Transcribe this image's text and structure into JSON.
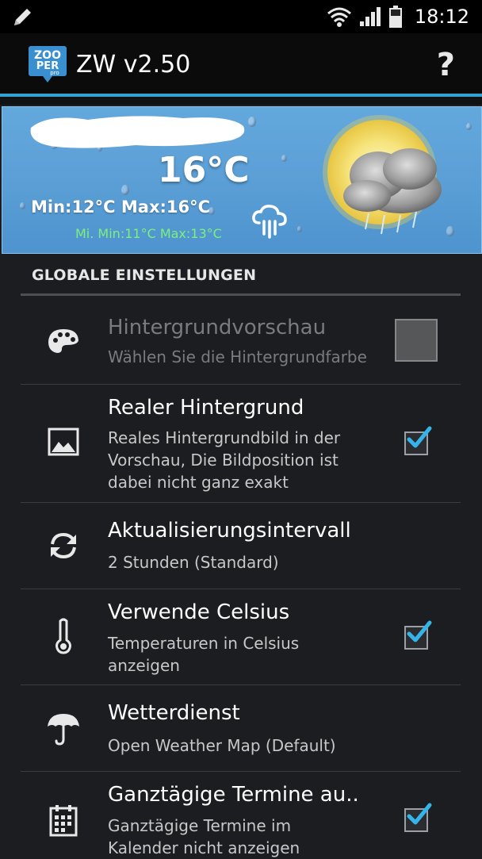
{
  "status_bar": {
    "time": "18:12",
    "icons": [
      "pencil-icon",
      "wifi-icon",
      "signal-icon",
      "battery-icon"
    ]
  },
  "action_bar": {
    "logo_text_top": "ZOO",
    "logo_text_bottom": "PER",
    "logo_text_small": "pro",
    "title": "ZW v2.50",
    "help_label": "?"
  },
  "preview": {
    "temperature": "16°C",
    "min_max": "Min:12°C Max:16°C",
    "mi_min_max": "Mi. Min:11°C Max:13°C"
  },
  "settings": {
    "section_title": "GLOBALE EINSTELLUNGEN",
    "items": [
      {
        "title": "Hintergrundvorschau",
        "summary": [
          "Wählen Sie die Hintergrundfarbe"
        ],
        "icon": "palette-icon",
        "control": "color-swatch",
        "enabled": false,
        "swatch_color": "#555759"
      },
      {
        "title": "Realer Hintergrund",
        "summary": [
          "Reales Hintergrundbild in der",
          "Vorschau, Die Bildposition ist",
          "dabei nicht ganz exakt"
        ],
        "icon": "image-icon",
        "control": "checkbox",
        "checked": true
      },
      {
        "title": "Aktualisierungsintervall",
        "summary": [
          "2 Stunden (Standard)"
        ],
        "icon": "refresh-icon",
        "control": "none"
      },
      {
        "title": "Verwende Celsius",
        "summary": [
          "Temperaturen in Celsius",
          "anzeigen"
        ],
        "icon": "thermometer-icon",
        "control": "checkbox",
        "checked": true
      },
      {
        "title": "Wetterdienst",
        "summary": [
          "Open Weather Map (Default)"
        ],
        "icon": "umbrella-icon",
        "control": "none"
      },
      {
        "title": "Ganztägige Termine au..",
        "summary": [
          "Ganztägige Termine im",
          "Kalender nicht anzeigen"
        ],
        "icon": "calendar-icon",
        "control": "checkbox",
        "checked": true
      }
    ]
  },
  "colors": {
    "accent": "#33a3d6",
    "check": "#35b4ea",
    "background": "#1b1d20"
  }
}
